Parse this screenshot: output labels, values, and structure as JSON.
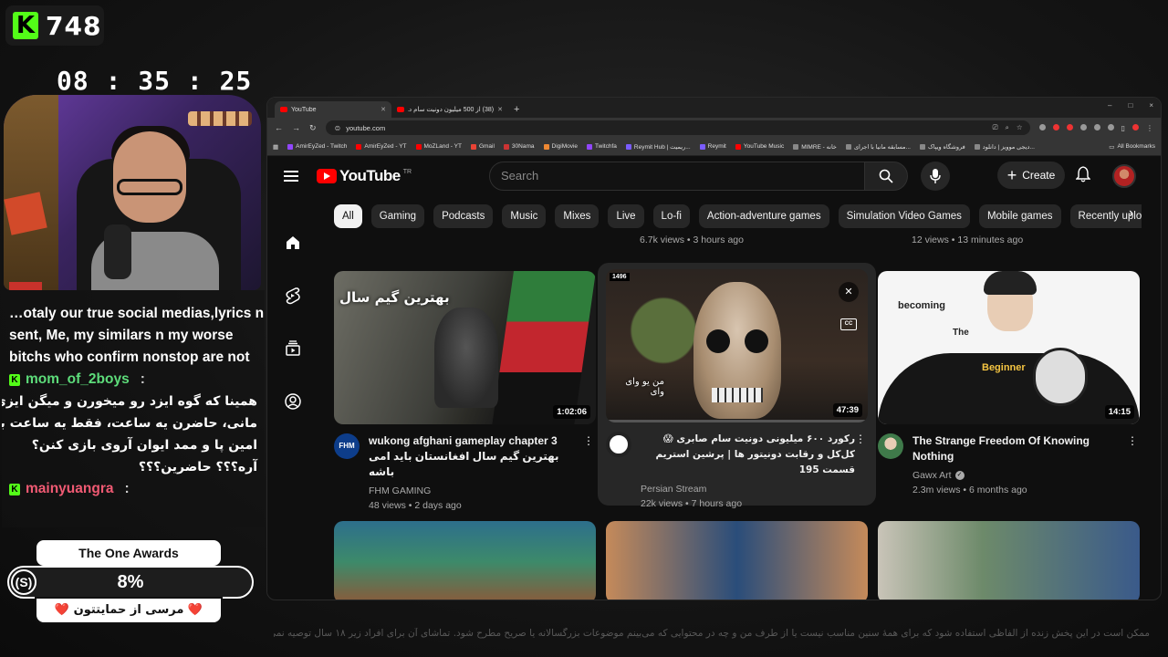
{
  "overlay": {
    "viewer_count": "748",
    "timer": "08 : 35 : 25",
    "chat": {
      "lines": [
        {
          "type": "text",
          "text": "…otaly our true social medias,lyrics n"
        },
        {
          "type": "text",
          "text": "sent, Me, my similars n my worse"
        },
        {
          "type": "text",
          "text": "bitchs who confirm nonstop are not"
        }
      ],
      "user1": "mom_of_2boys",
      "msg1": [
        "همینا که گوه ایزد رو میخورن و میگن ایزی",
        "مانی، حاضرن یه ساعت، فقط یه ساعت با",
        "امین پا و ممد ایوان آروی بازی کنن؟",
        "آره؟؟؟ حاضرین؟؟؟"
      ],
      "user2": "mainyuangra"
    },
    "award": {
      "title": "The One Awards",
      "percent": "8%",
      "coin": "(S)",
      "thanks": "❤️ مرسی از حمایتتون ❤️"
    },
    "disclaimer": "ممکن است در این پخش زنده از الفاظی استفاده شود که برای همهٔ سنین مناسب نیست یا از طرف من و چه در محتوایی که می‌بینم موضوعات بزرگسالانه یا صریح مطرح شود. تماشای آن برای افراد زیر ۱۸ سال توصیه نمی‌شود."
  },
  "browser": {
    "tabs": [
      {
        "title": "YouTube",
        "active": true
      },
      {
        "title": "(38) از 500 میلیون دونیت سام د...",
        "active": false
      }
    ],
    "url": "youtube.com",
    "bookmarks": [
      "AmirEyZed - Twitch",
      "AmirEyZed - YT",
      "MoZLand - YT",
      "Gmail",
      "30Nama",
      "DigiMovie",
      "Twitchfa",
      "Reymit Hub | ریمیت...",
      "Reymit",
      "YouTube Music",
      "MIMRE - خانه",
      "مسابقه مانیا با اجرای...",
      "فروشگاه ویپاک",
      "دیجی موویز | دانلود..."
    ],
    "all_bookmarks": "All Bookmarks",
    "window_controls": [
      "–",
      "□",
      "×"
    ]
  },
  "youtube": {
    "logo_text": "YouTube",
    "country_code": "TR",
    "search_placeholder": "Search",
    "create_label": "Create",
    "chips": [
      "All",
      "Gaming",
      "Podcasts",
      "Music",
      "Mixes",
      "Live",
      "Lo-fi",
      "Action-adventure games",
      "Simulation Video Games",
      "Mobile games",
      "Recently uploaded"
    ],
    "prev_row_meta": [
      "6.7k views • 3 hours ago",
      "12 views • 13 minutes ago"
    ],
    "videos": [
      {
        "title": "wukong afghani gameplay chapter 3 بهترین گیم سال افغانستان باید امی باشه",
        "channel": "FHM GAMING",
        "meta": "48 views • 2 days ago",
        "duration": "1:02:06",
        "thumb_text": "بهترین گیم سال",
        "avatar_text": "FHM"
      },
      {
        "title": "رکورد ۶۰۰ میلیونی دونیت سام صابری 😱 کل‌کل و رقابت دونیتور ها | پرشین استریم قسمت 195",
        "channel": "Persian Stream",
        "meta": "22k views • 7 hours ago",
        "duration": "47:39",
        "thumb_text": "من یو وای وای",
        "badge": "1496"
      },
      {
        "title": "The Strange Freedom Of Knowing Nothing",
        "channel": "Gawx Art",
        "meta": "2.3m views • 6 months ago",
        "duration": "14:15",
        "thumb_text": [
          "becoming",
          "The",
          "Beginner"
        ]
      }
    ]
  }
}
